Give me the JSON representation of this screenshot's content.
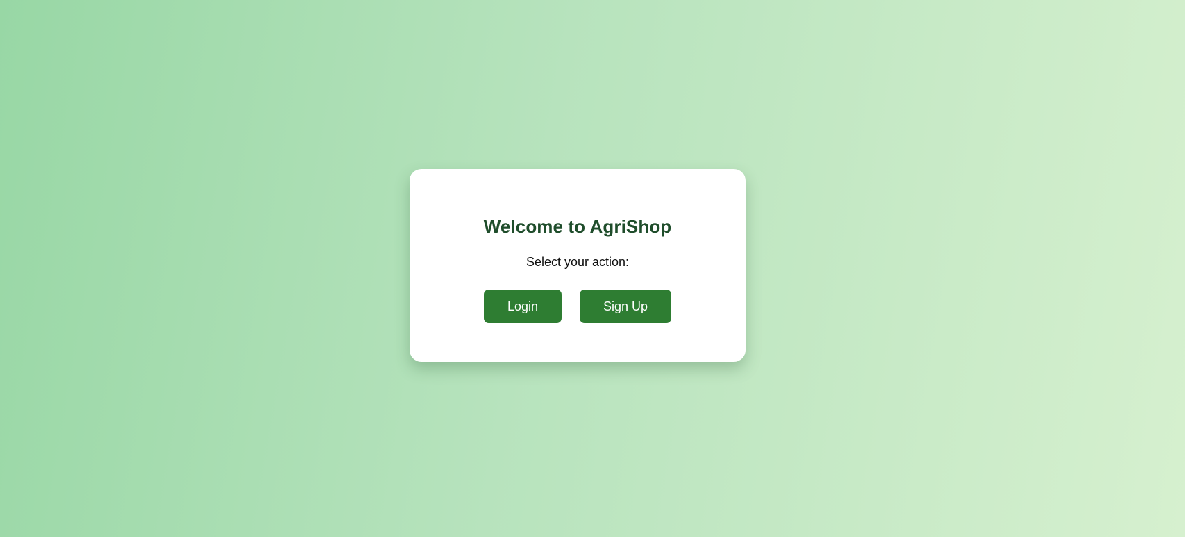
{
  "card": {
    "title": "Welcome to AgriShop",
    "subtitle": "Select your action:",
    "login_label": "Login",
    "signup_label": "Sign Up"
  },
  "colors": {
    "accent": "#2e7d32",
    "title": "#1f4d2b",
    "background_start": "#98d7a5",
    "background_end": "#d6f0cf"
  }
}
